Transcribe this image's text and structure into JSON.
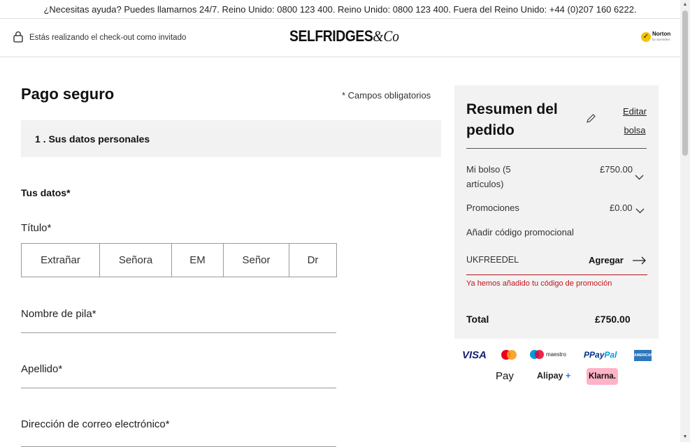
{
  "help_bar": {
    "text": "¿Necesitas ayuda? Puedes llamarnos 24/7. Reino Unido: 0800 123 400. Reino Unido: 0800 123 400. Fuera del Reino Unido: +44 (0)207 160 6222."
  },
  "header": {
    "guest_text": "Estás realizando el check-out como invitado",
    "logo_main": "SELFRIDGES",
    "logo_amp": "&Co",
    "norton_label": "Norton",
    "norton_sub": "by Symantec"
  },
  "form": {
    "page_title": "Pago seguro",
    "required_note": "* Campos obligatorios",
    "step_label": "1 . Sus datos personales",
    "section_title": "Tus datos*",
    "title_label": "Título*",
    "title_options": [
      "Extrañar",
      "Señora",
      "EM",
      "Señor",
      "Dr"
    ],
    "first_name_label": "Nombre de pila*",
    "last_name_label": "Apellido*",
    "email_label": "Dirección de correo electrónico*"
  },
  "summary": {
    "title": "Resumen del pedido",
    "edit_link": "Editar bolsa",
    "bag_label": "Mi bolso (5 artículos)",
    "bag_value": "£750.00",
    "promotions_label": "Promociones",
    "promotions_value": "£0.00",
    "add_promo_label": "Añadir código promocional",
    "promo_code": "UKFREEDEL",
    "apply_label": "Agregar",
    "promo_message": "Ya hemos añadido tu código de promoción",
    "total_label": "Total",
    "total_value": "£750.00"
  },
  "payments": {
    "visa": "VISA",
    "maestro": "maestro",
    "paypal_a": "Pay",
    "paypal_b": "Pal",
    "amex": "AMERICAN EXPRESS",
    "applepay": "Pay",
    "alipay": "Alipay",
    "klarna": "Klarna."
  },
  "colors": {
    "accent_red": "#c0141e",
    "summary_bg": "#f2f2f2",
    "klarna_pink": "#ffb3c7"
  }
}
